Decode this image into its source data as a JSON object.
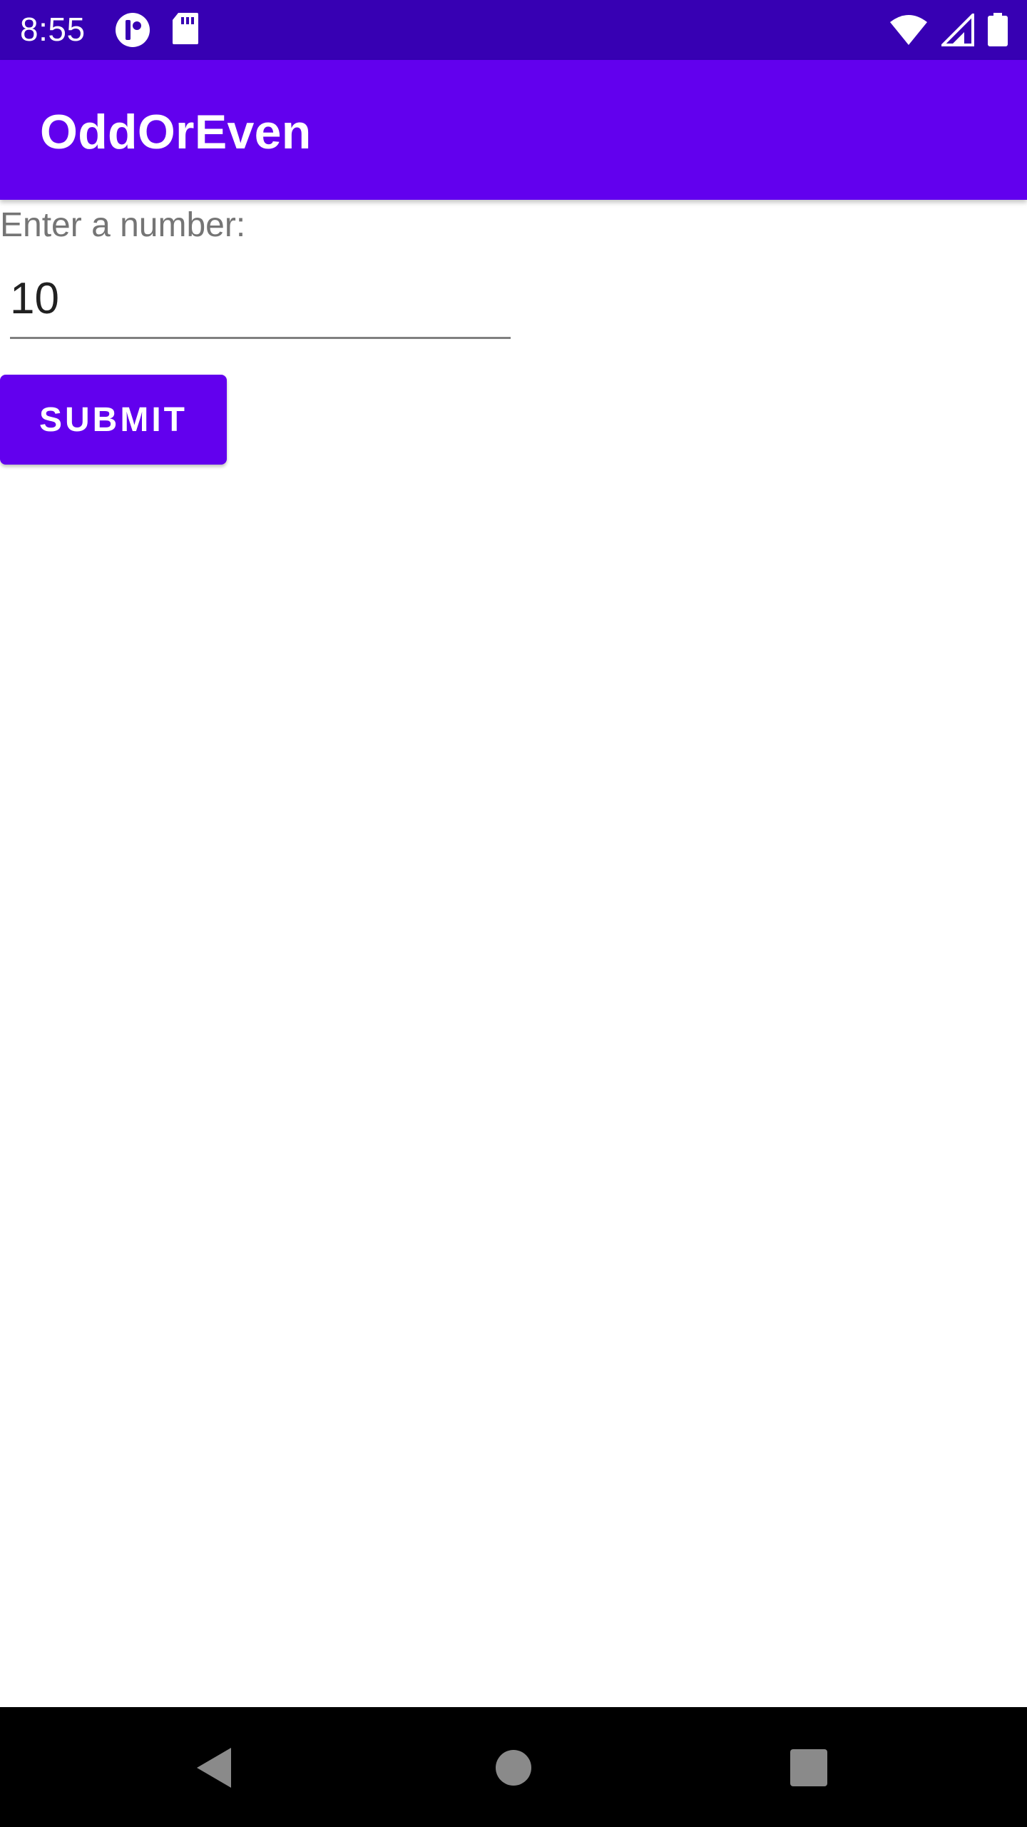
{
  "status_bar": {
    "time": "8:55",
    "left_icons": [
      "app-notification-icon",
      "sd-card-icon"
    ],
    "right_icons": [
      "wifi-icon",
      "cell-signal-icon",
      "battery-icon"
    ],
    "background": "#3700b3"
  },
  "app_bar": {
    "title": "OddOrEven",
    "background": "#6200ee"
  },
  "form": {
    "prompt": "Enter a number:",
    "number_value": "10",
    "submit_label": "SUBMIT",
    "accent": "#6200ee"
  },
  "nav_bar": {
    "buttons": [
      "back-icon",
      "home-icon",
      "recents-icon"
    ]
  }
}
